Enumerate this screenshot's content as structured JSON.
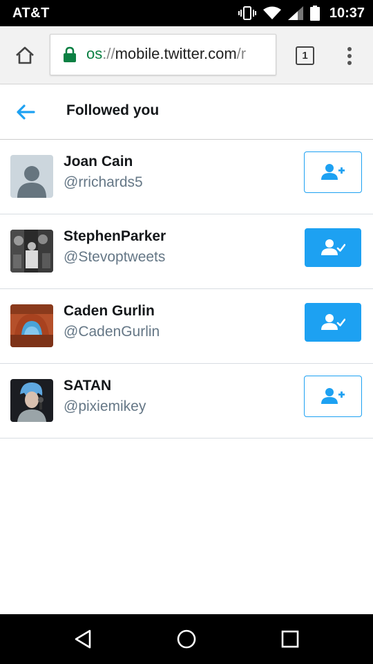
{
  "status_bar": {
    "carrier": "AT&T",
    "time": "10:37",
    "icons": [
      "vibrate-icon",
      "wifi-icon",
      "signal-icon",
      "battery-icon"
    ]
  },
  "browser": {
    "url_scheme": "os",
    "url_separator": "://",
    "url_host": "mobile.twitter.com",
    "url_path": "/r",
    "tab_count": "1",
    "icons": [
      "home-icon",
      "lock-icon",
      "overflow-menu-icon"
    ]
  },
  "page": {
    "title": "Followed you",
    "back_icon": "arrow-left-icon"
  },
  "users": [
    {
      "name": "Joan Cain",
      "handle": "@rrichards5",
      "following": false,
      "avatar": "default-avatar"
    },
    {
      "name": "Stephen⁠⁠Parker",
      "handle": "@Stevoptweets",
      "following": true,
      "avatar": "photo-avatar"
    },
    {
      "name": "Caden Gurlin",
      "handle": "@CadenGurlin",
      "following": true,
      "avatar": "photo-avatar"
    },
    {
      "name": "SATAN",
      "handle": "@pixiemikey",
      "following": false,
      "avatar": "photo-avatar"
    }
  ],
  "nav_bar": {
    "icons": [
      "back-triangle-icon",
      "home-circle-icon",
      "recents-square-icon"
    ]
  },
  "colors": {
    "accent": "#1da1f2",
    "text_primary": "#14171a",
    "text_secondary": "#657786",
    "secure_green": "#0b8043"
  }
}
